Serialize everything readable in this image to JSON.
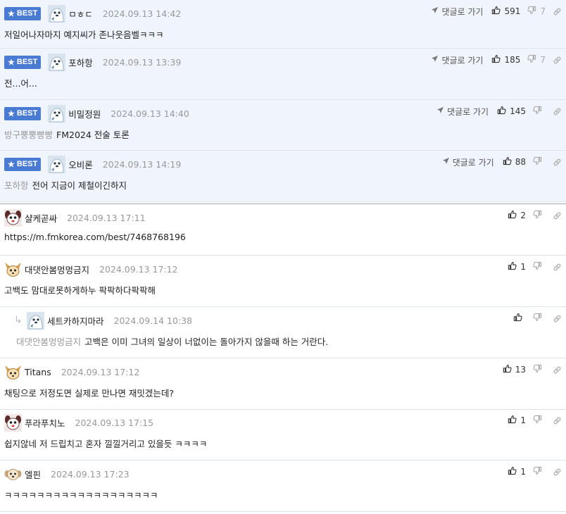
{
  "labels": {
    "best": "BEST",
    "goto": "댓글로 가기"
  },
  "colors": {
    "best_badge": "#4a7bd2",
    "best_row_bg": "#f0f4fd",
    "meta_text": "#999999"
  },
  "best_comments": [
    {
      "badge": "BEST",
      "author": "ㅁㅎㄷ",
      "avatar_icon": "ice-bear-avatar",
      "date": "2024.09.13 14:42",
      "parent": "",
      "text": "저일어나자마지 예지씨가 존나웃음벨ㅋㅋㅋ",
      "goto": "댓글로 가기",
      "up": "591",
      "down": "7"
    },
    {
      "badge": "BEST",
      "author": "포하항",
      "avatar_icon": "ice-bear-avatar",
      "date": "2024.09.13 13:39",
      "parent": "",
      "text": "전...어...",
      "goto": "댓글로 가기",
      "up": "185",
      "down": "7"
    },
    {
      "badge": "BEST",
      "author": "비밀정원",
      "avatar_icon": "ice-bear-avatar",
      "date": "2024.09.13 14:40",
      "parent": "방구뿡뿡빵빵",
      "text": "FM2024 전술 토론",
      "goto": "댓글로 가기",
      "up": "145",
      "down": ""
    },
    {
      "badge": "BEST",
      "author": "오비론",
      "avatar_icon": "ice-bear-avatar",
      "date": "2024.09.13 14:19",
      "parent": "포하항",
      "text": "전어 지금이 제철이긴하지",
      "goto": "댓글로 가기",
      "up": "88",
      "down": ""
    }
  ],
  "comments": [
    {
      "author": "샬케곧싸",
      "avatar_icon": "skull-dog-avatar",
      "date": "2024.09.13 17:11",
      "parent": "",
      "text": "https://m.fmkorea.com/best/7468768196",
      "up": "2",
      "down": ""
    },
    {
      "author": "대댓안봄멍멍금지",
      "avatar_icon": "fox-avatar",
      "date": "2024.09.13 17:12",
      "parent": "",
      "text": "고백도 맘대로못하게하누 팍팍하다팍팍해",
      "up": "1",
      "down": ""
    },
    {
      "author": "세트카하지마라",
      "avatar_icon": "ice-bear-avatar",
      "date": "2024.09.14 10:38",
      "parent": "대댓안봄멍멍금지",
      "text": "고백은 이미 그녀의 일상이 너없이는 돌아가지 않을때 하는 거란다.",
      "up": "",
      "down": "",
      "is_reply": true
    },
    {
      "author": "Titans",
      "avatar_icon": "fox-avatar",
      "date": "2024.09.13 17:12",
      "parent": "",
      "text": "채팅으로 저정도면 실제로 만나면 재밋겠는데?",
      "up": "13",
      "down": ""
    },
    {
      "author": "푸라푸치노",
      "avatar_icon": "skull-dog-avatar",
      "date": "2024.09.13 17:15",
      "parent": "",
      "text": "쉽지않네 저 드립치고 혼자 낄낄거리고 있을듯 ㅋㅋㅋㅋ",
      "up": "1",
      "down": ""
    },
    {
      "author": "엘핀",
      "avatar_icon": "puppy-avatar",
      "date": "2024.09.13 17:23",
      "parent": "",
      "text": "ㅋㅋㅋㅋㅋㅋㅋㅋㅋㅋㅋㅋㅋㅋㅋㅋㅋㅋㅋ",
      "up": "1",
      "down": ""
    }
  ]
}
